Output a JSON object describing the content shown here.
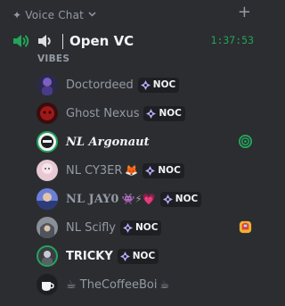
{
  "category": {
    "spark": "✦",
    "title": "Voice Chat",
    "add_label": "+"
  },
  "channel": {
    "name": "Open VC",
    "timer": "1:37:53"
  },
  "group_label": "VIBES",
  "tag_label": "NOC",
  "colors": {
    "speaking": "#23a559",
    "background": "#2b2d31",
    "tag_bg": "#1e1f22"
  },
  "members": [
    {
      "name": "Doctordeed",
      "emoji": "",
      "tag": true,
      "speaking": false,
      "avatar": "purple-figure"
    },
    {
      "name": "Ghost Nexus",
      "emoji": "",
      "tag": true,
      "speaking": false,
      "avatar": "red-mask"
    },
    {
      "name": "NL Argonaut",
      "emoji": "",
      "tag": false,
      "speaking": true,
      "avatar": "masked-face",
      "right": "streaming-icon"
    },
    {
      "name": "NL CY3ER",
      "emoji": "🦊",
      "tag": true,
      "speaking": false,
      "avatar": "pink-character"
    },
    {
      "name": "NL JAY0",
      "emoji": "👾⚡💗",
      "tag": true,
      "speaking": false,
      "avatar": "blue-sky"
    },
    {
      "name": "NL Scifly",
      "emoji": "",
      "tag": true,
      "speaking": false,
      "avatar": "grey-hoodie",
      "right": "activity-icon"
    },
    {
      "name": "TRICKY",
      "emoji": "",
      "tag": true,
      "speaking": true,
      "avatar": "dark-figure"
    },
    {
      "name": "☕ TheCoffeeBoi",
      "emoji": "☕",
      "tag": false,
      "speaking": false,
      "avatar": "coffee-cup"
    }
  ]
}
